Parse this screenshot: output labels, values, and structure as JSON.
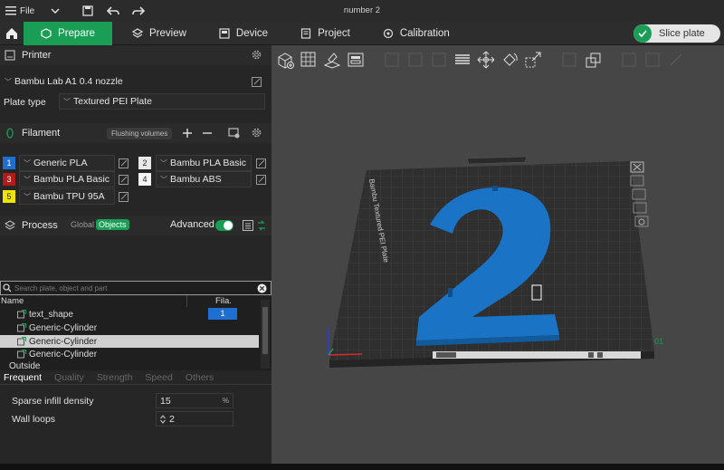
{
  "titlebar": {
    "file_label": "File",
    "window_title": "number 2"
  },
  "nav": {
    "tabs": [
      {
        "label": "Prepare"
      },
      {
        "label": "Preview"
      },
      {
        "label": "Device"
      },
      {
        "label": "Project"
      },
      {
        "label": "Calibration"
      }
    ],
    "slice_label": "Slice plate"
  },
  "printer": {
    "header": "Printer",
    "printer_name": "Bambu Lab A1 0.4 nozzle",
    "plate_type_label": "Plate type",
    "plate_type_value": "Textured PEI Plate"
  },
  "filament": {
    "header": "Filament",
    "flushing_label": "Flushing volumes",
    "slots": [
      {
        "num": "1",
        "name": "Generic PLA",
        "color": "#1e6fd0"
      },
      {
        "num": "2",
        "name": "Bambu PLA Basic",
        "color": "#e8e8e8"
      },
      {
        "num": "3",
        "name": "Bambu PLA Basic",
        "color": "#b01c1c"
      },
      {
        "num": "4",
        "name": "Bambu ABS",
        "color": "#f5f5f5"
      },
      {
        "num": "5",
        "name": "Bambu TPU 95A",
        "color": "#f2e200"
      }
    ]
  },
  "process": {
    "header": "Process",
    "global_label": "Global",
    "objects_label": "Objects",
    "advanced_label": "Advanced",
    "search_placeholder": "Search plate, object and part",
    "columns": {
      "name": "Name",
      "fila": "Fila."
    },
    "items": [
      {
        "name": "text_shape",
        "fila": "1"
      },
      {
        "name": "Generic-Cylinder",
        "fila": ""
      },
      {
        "name": "Generic-Cylinder",
        "fila": ""
      },
      {
        "name": "Generic-Cylinder",
        "fila": ""
      },
      {
        "name": "Outside",
        "fila": ""
      }
    ],
    "tabs": [
      "Frequent",
      "Quality",
      "Strength",
      "Speed",
      "Others"
    ],
    "params": [
      {
        "name": "Sparse infill density",
        "value": "15",
        "unit": "%"
      },
      {
        "name": "Wall loops",
        "value": "2",
        "unit": ""
      }
    ]
  },
  "plate": {
    "label": "Bambu Textured PEI Plate",
    "digit": "2",
    "plate_number": "01",
    "model_color": "#1a73c4"
  }
}
